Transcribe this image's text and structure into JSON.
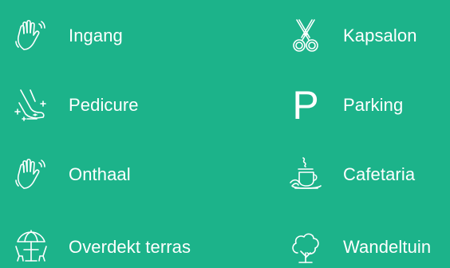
{
  "items": [
    {
      "label": "Ingang",
      "icon": "waving-hand-icon"
    },
    {
      "label": "Kapsalon",
      "icon": "scissors-icon"
    },
    {
      "label": "Pedicure",
      "icon": "foot-sparkle-icon"
    },
    {
      "label": "Parking",
      "icon": "parking-icon",
      "glyph": "P"
    },
    {
      "label": "Onthaal",
      "icon": "waving-hand-icon"
    },
    {
      "label": "Cafetaria",
      "icon": "coffee-cup-icon"
    },
    {
      "label": "Overdekt terras",
      "icon": "terrace-umbrella-icon"
    },
    {
      "label": "Wandeltuin",
      "icon": "garden-tree-icon"
    }
  ],
  "colors": {
    "background": "#1cb38a",
    "foreground": "#ffffff"
  }
}
